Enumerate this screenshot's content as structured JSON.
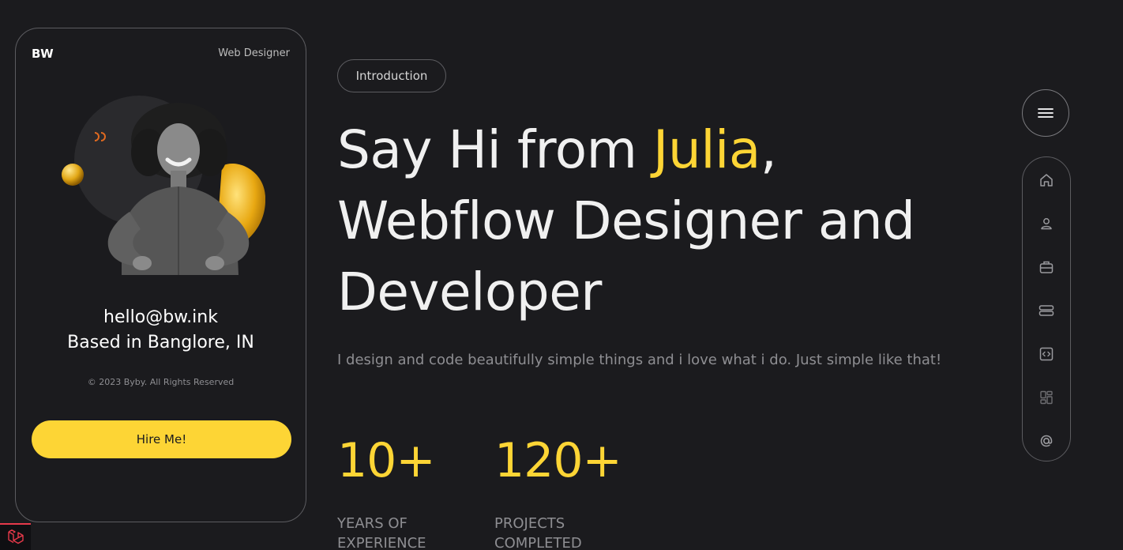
{
  "profile": {
    "logo": "BW",
    "role": "Web Designer",
    "email": "hello@bw.ink",
    "location": "Based in Banglore, IN",
    "copyright": "© 2023 Byby. All Rights Reserved",
    "hire_label": "Hire Me!"
  },
  "main": {
    "intro_label": "Introduction",
    "headline_prefix": "Say Hi from ",
    "headline_name": "Julia",
    "headline_line1_suffix": ",",
    "headline_line2": "Webflow Designer and",
    "headline_line3": "Developer",
    "tagline": "I design and code beautifully simple things and i love what i do. Just simple like that!",
    "stats": [
      {
        "value": "10+",
        "label": "Years of Experience"
      },
      {
        "value": "120+",
        "label": "Projects Completed"
      }
    ]
  },
  "nav": {
    "menu_icon": "hamburger-icon",
    "items": [
      {
        "icon": "home-icon"
      },
      {
        "icon": "user-icon"
      },
      {
        "icon": "briefcase-icon"
      },
      {
        "icon": "server-icon"
      },
      {
        "icon": "code-icon"
      },
      {
        "icon": "grid-icon"
      },
      {
        "icon": "at-icon"
      }
    ]
  },
  "colors": {
    "background": "#1b1b1e",
    "accent": "#fdd535",
    "muted_text": "#8e8e92",
    "border": "#5c5c60"
  }
}
